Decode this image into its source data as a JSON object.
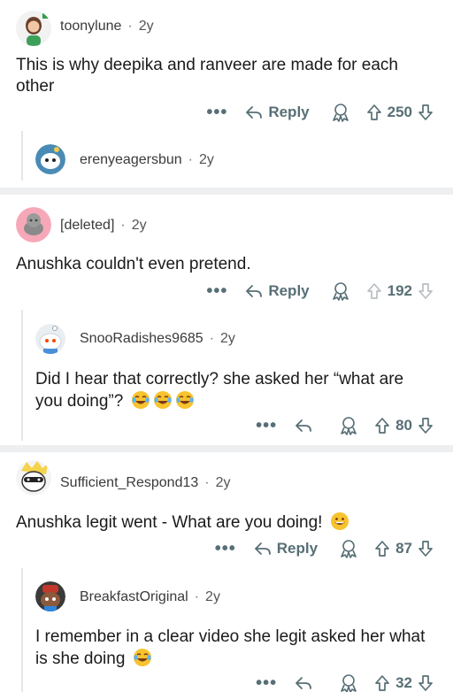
{
  "comments": [
    {
      "user": "toonylune",
      "dot": "·",
      "age": "2y",
      "text": "This is why deepika and ranveer are made for each other",
      "reply_label": "Reply",
      "score": "250",
      "replies": [
        {
          "user": "erenyeagersbun",
          "dot": "·",
          "age": "2y"
        }
      ]
    },
    {
      "user": "[deleted]",
      "dot": "·",
      "age": "2y",
      "text": "Anushka couldn't even pretend.",
      "reply_label": "Reply",
      "score": "192",
      "replies": [
        {
          "user": "SnooRadishes9685",
          "dot": "·",
          "age": "2y",
          "text": "Did I hear that correctly? she asked her “what are you doing”?",
          "score": "80"
        }
      ]
    },
    {
      "user": "Sufficient_Respond13",
      "dot": "·",
      "age": "2y",
      "text": "Anushka legit went - What are you doing!",
      "reply_label": "Reply",
      "score": "87",
      "replies": [
        {
          "user": "BreakfastOriginal",
          "dot": "·",
          "age": "2y",
          "text": "I remember in a clear video she legit asked her what is she doing",
          "score": "32"
        }
      ]
    }
  ],
  "more_icon": "•••",
  "icons": [
    "reply-arrow-icon",
    "award-icon",
    "upvote-icon",
    "downvote-icon",
    "joy-emoji",
    "grin-emoji"
  ],
  "colors": {
    "separator": "#eeeff1",
    "action_gray": "#576f76",
    "thread_line": "#e5e6e8"
  }
}
